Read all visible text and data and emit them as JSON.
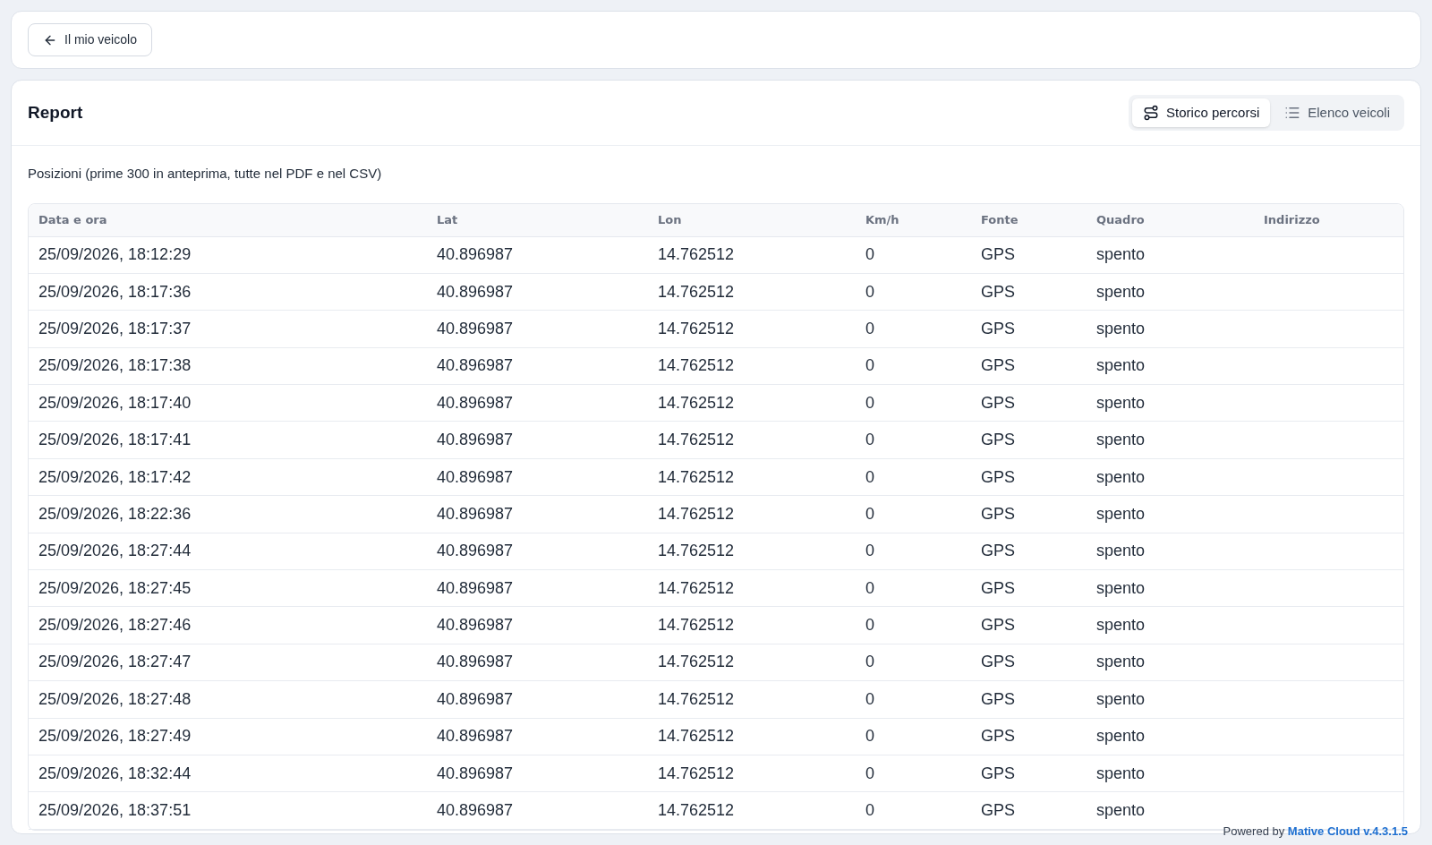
{
  "back_button": {
    "label": "Il mio veicolo"
  },
  "report": {
    "title": "Report",
    "view_tabs": [
      {
        "label": "Storico percorsi",
        "kind": "route",
        "selected": true
      },
      {
        "label": "Elenco veicoli",
        "kind": "list",
        "selected": false
      }
    ],
    "caption": "Posizioni (prime 300 in anteprima, tutte nel PDF e nel CSV)",
    "table": {
      "columns": [
        "Data e ora",
        "Lat",
        "Lon",
        "Km/h",
        "Fonte",
        "Quadro",
        "Indirizzo"
      ],
      "rows": [
        [
          "25/09/2026, 18:12:29",
          "40.896987",
          "14.762512",
          "0",
          "GPS",
          "spento"
        ],
        [
          "25/09/2026, 18:17:36",
          "40.896987",
          "14.762512",
          "0",
          "GPS",
          "spento"
        ],
        [
          "25/09/2026, 18:17:37",
          "40.896987",
          "14.762512",
          "0",
          "GPS",
          "spento"
        ],
        [
          "25/09/2026, 18:17:38",
          "40.896987",
          "14.762512",
          "0",
          "GPS",
          "spento"
        ],
        [
          "25/09/2026, 18:17:40",
          "40.896987",
          "14.762512",
          "0",
          "GPS",
          "spento"
        ],
        [
          "25/09/2026, 18:17:41",
          "40.896987",
          "14.762512",
          "0",
          "GPS",
          "spento"
        ],
        [
          "25/09/2026, 18:17:42",
          "40.896987",
          "14.762512",
          "0",
          "GPS",
          "spento"
        ],
        [
          "25/09/2026, 18:22:36",
          "40.896987",
          "14.762512",
          "0",
          "GPS",
          "spento"
        ],
        [
          "25/09/2026, 18:27:44",
          "40.896987",
          "14.762512",
          "0",
          "GPS",
          "spento"
        ],
        [
          "25/09/2026, 18:27:45",
          "40.896987",
          "14.762512",
          "0",
          "GPS",
          "spento"
        ],
        [
          "25/09/2026, 18:27:46",
          "40.896987",
          "14.762512",
          "0",
          "GPS",
          "spento"
        ],
        [
          "25/09/2026, 18:27:47",
          "40.896987",
          "14.762512",
          "0",
          "GPS",
          "spento"
        ],
        [
          "25/09/2026, 18:27:48",
          "40.896987",
          "14.762512",
          "0",
          "GPS",
          "spento"
        ],
        [
          "25/09/2026, 18:27:49",
          "40.896987",
          "14.762512",
          "0",
          "GPS",
          "spento"
        ],
        [
          "25/09/2026, 18:32:44",
          "40.896987",
          "14.762512",
          "0",
          "GPS",
          "spento"
        ],
        [
          "25/09/2026, 18:37:51",
          "40.896987",
          "14.762512",
          "0",
          "GPS",
          "spento"
        ]
      ]
    }
  },
  "footer": {
    "prefix": "Powered by",
    "brand": "Mative Cloud v.4.3.1.5"
  }
}
